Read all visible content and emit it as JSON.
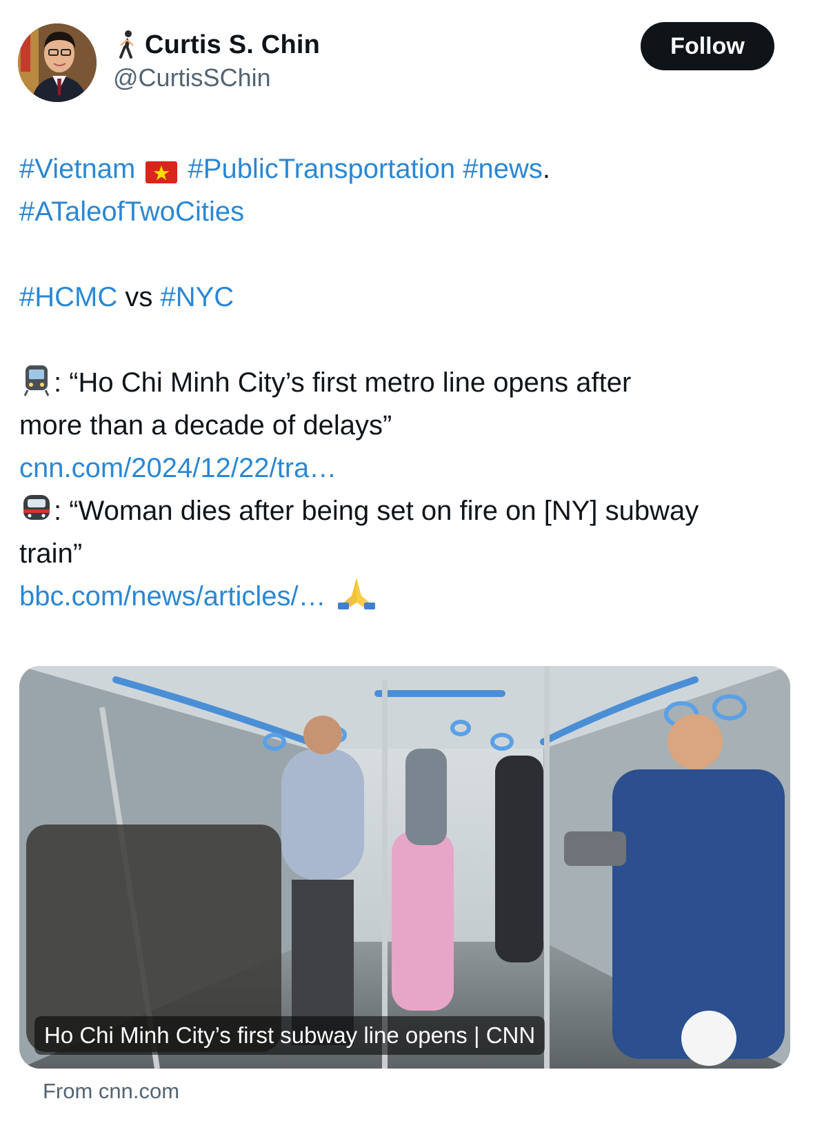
{
  "author": {
    "display_name": "Curtis S. Chin",
    "handle": "@CurtisSChin",
    "name_emoji": "person-walking-icon"
  },
  "follow_label": "Follow",
  "tweet": {
    "line1": {
      "tag_vietnam": "#Vietnam",
      "tag_public_transportation": "#PublicTransportation",
      "tag_news": "#news",
      "trailing": "."
    },
    "line2": {
      "tag_tale": "#ATaleofTwoCities"
    },
    "line3": {
      "tag_hcmc": "#HCMC",
      "vs": "vs",
      "tag_nyc": "#NYC"
    },
    "line4": {
      "text": ": “Ho Chi Minh City’s first metro line opens after"
    },
    "line5": {
      "text": "more than a decade of delays”"
    },
    "line6": {
      "link": "cnn.com/2024/12/22/tra…"
    },
    "line7": {
      "text": ": “Woman dies after being set on fire on [NY] subway"
    },
    "line8": {
      "text": "train”"
    },
    "line9": {
      "link": "bbc.com/news/articles/…"
    }
  },
  "card": {
    "caption": "Ho Chi Minh City’s first subway line opens | CNN",
    "source": "From cnn.com"
  },
  "colors": {
    "link": "#2b87d3",
    "follow_bg": "#0f1419",
    "secondary_text": "#536471"
  }
}
